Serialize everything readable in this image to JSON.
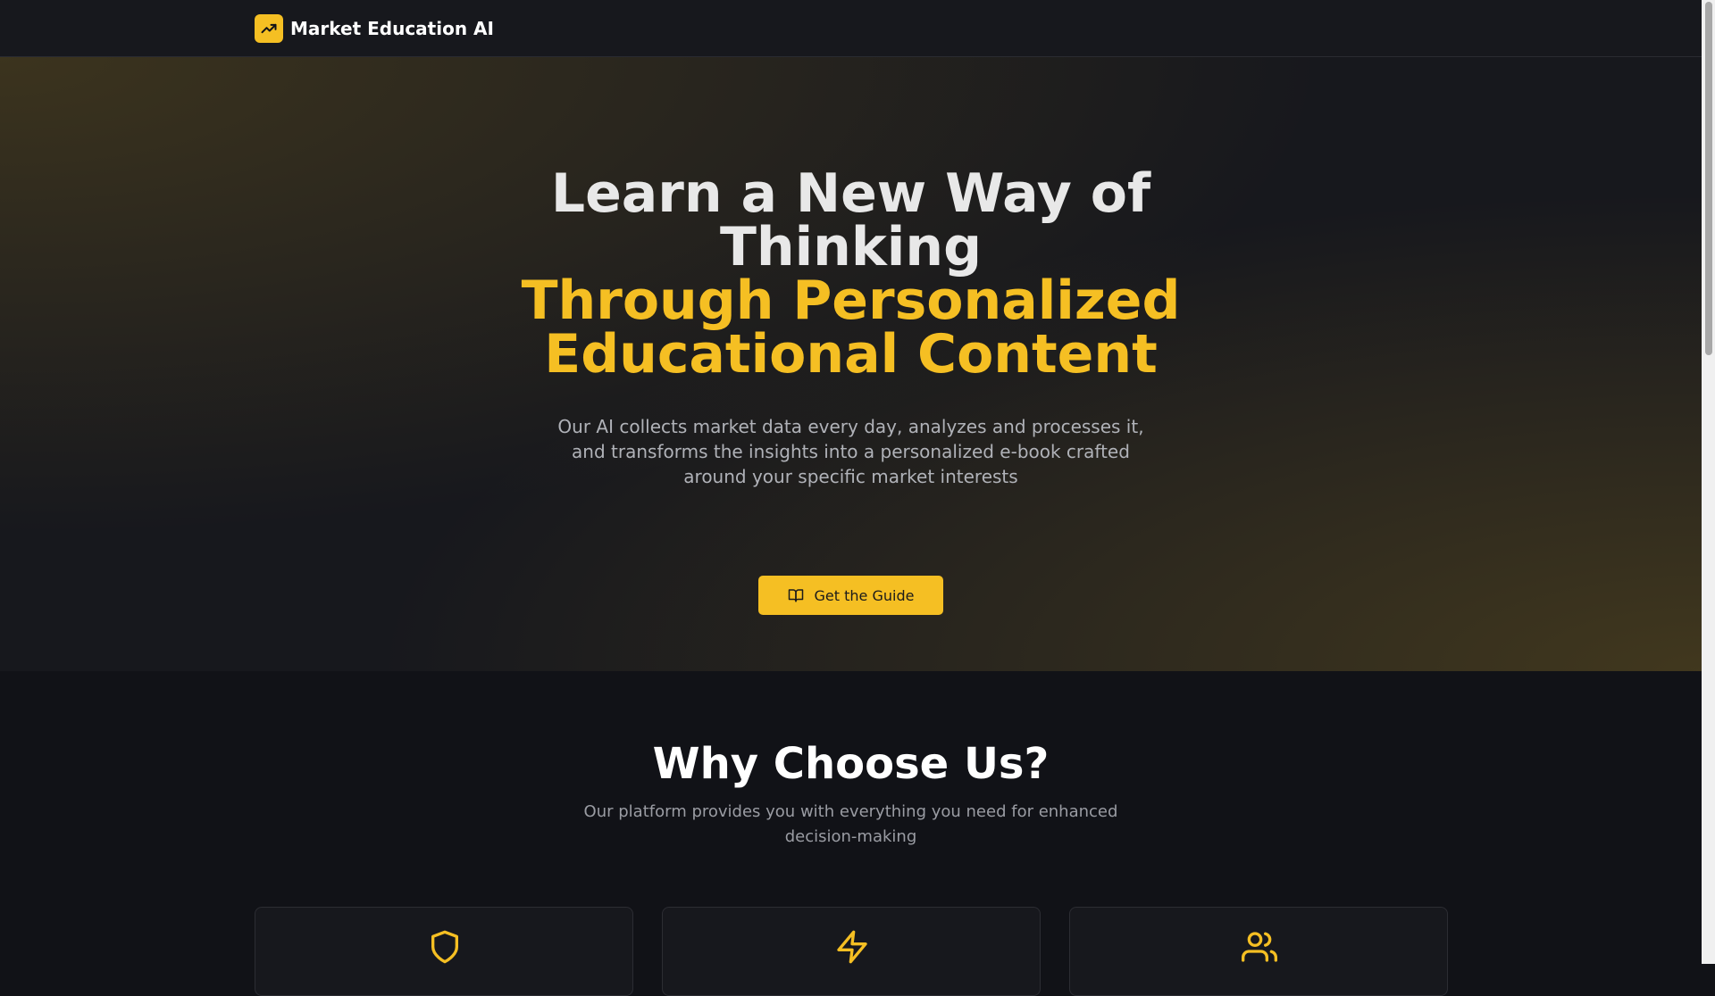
{
  "header": {
    "brand_name": "Market Education AI",
    "brand_icon": "trending-up-chart-icon"
  },
  "hero": {
    "headline_line1": "Learn a New Way of Thinking",
    "headline_line2": "Through Personalized Educational Content",
    "description": "Our AI collects market data every day, analyzes and processes it, and transforms the insights into a personalized e-book crafted around your specific market interests",
    "cta_label": "Get the Guide",
    "cta_icon": "book-open-icon"
  },
  "features": {
    "title": "Why Choose Us?",
    "subtitle": "Our platform provides you with everything you need for enhanced decision-making",
    "cards": [
      {
        "icon": "shield-icon"
      },
      {
        "icon": "lightning-icon"
      },
      {
        "icon": "users-icon"
      }
    ]
  },
  "colors": {
    "accent": "#f5bf23",
    "background": "#111217",
    "header_bg": "#17181d",
    "text_primary": "#ffffff",
    "text_muted": "#b0b2b8"
  }
}
